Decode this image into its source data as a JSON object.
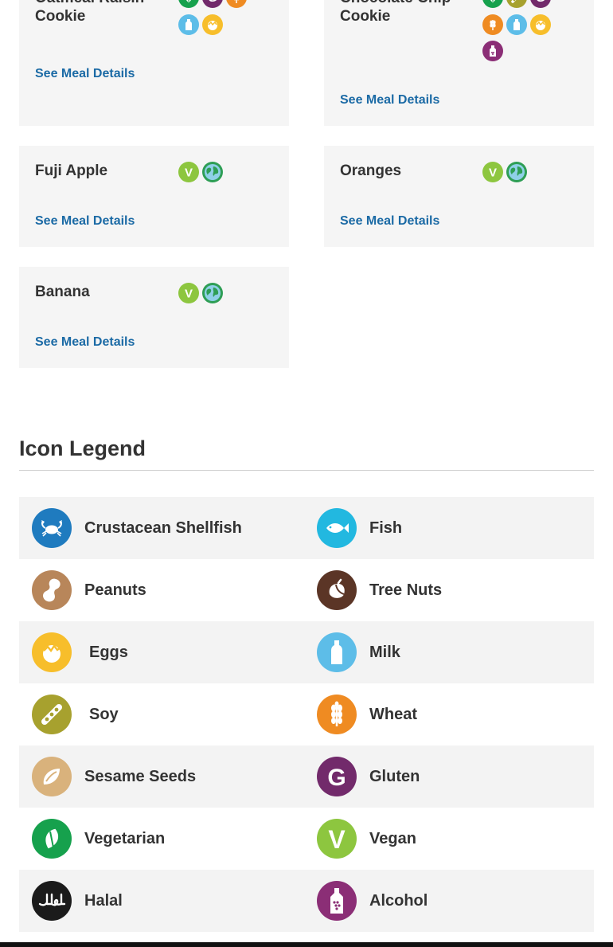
{
  "meals": [
    {
      "name": "Oatmeal Raisin Cookie",
      "link": "See Meal Details"
    },
    {
      "name": "Chocolate Chip Cookie",
      "link": "See Meal Details"
    },
    {
      "name": "Fuji Apple",
      "link": "See Meal Details"
    },
    {
      "name": "Oranges",
      "link": "See Meal Details"
    },
    {
      "name": "Banana",
      "link": "See Meal Details"
    }
  ],
  "legend": {
    "title": "Icon Legend",
    "items": [
      {
        "label": "Crustacean Shellfish",
        "icon": "crab-icon",
        "color": "#1f7bbf"
      },
      {
        "label": "Fish",
        "icon": "fish-icon",
        "color": "#22b8e0"
      },
      {
        "label": "Peanuts",
        "icon": "peanut-icon",
        "color": "#b8865a"
      },
      {
        "label": "Tree Nuts",
        "icon": "acorn-icon",
        "color": "#5b3526"
      },
      {
        "label": "Eggs",
        "icon": "egg-icon",
        "color": "#f7be2b"
      },
      {
        "label": "Milk",
        "icon": "milk-bottle-icon",
        "color": "#5dbde8"
      },
      {
        "label": "Soy",
        "icon": "soybean-icon",
        "color": "#a7a12e"
      },
      {
        "label": "Wheat",
        "icon": "wheat-icon",
        "color": "#ef8b22"
      },
      {
        "label": "Sesame Seeds",
        "icon": "sesame-seed-icon",
        "color": "#d9b27c"
      },
      {
        "label": "Gluten",
        "icon": "gluten-g-icon",
        "color": "#722a6b"
      },
      {
        "label": "Vegetarian",
        "icon": "leaf-icon",
        "color": "#16a14d"
      },
      {
        "label": "Vegan",
        "icon": "vegan-v-icon",
        "color": "#8dc63f"
      },
      {
        "label": "Halal",
        "icon": "halal-icon",
        "color": "#1b1b1b"
      },
      {
        "label": "Alcohol",
        "icon": "alcohol-bottle-icon",
        "color": "#8b2e76"
      }
    ]
  },
  "colors": {
    "card_bg": "#f5f5f5",
    "link": "#1b6aa5",
    "vegetarian": "#16a14d",
    "vegan": "#8dc63f",
    "globe": "#2e9e55",
    "gluten": "#722a6b",
    "wheat": "#ef8b22",
    "milk": "#5dbde8",
    "eggs": "#f7be2b",
    "soy": "#a7a12e",
    "alcohol": "#8b2e76"
  }
}
